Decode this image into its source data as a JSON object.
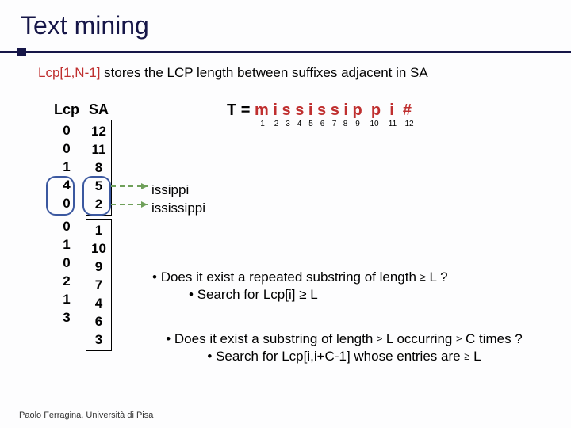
{
  "title": "Text mining",
  "subtitle_prefix": "Lcp[1,N-1]",
  "subtitle_rest": " stores the LCP length between suffixes adjacent in SA",
  "lcp_label": "Lcp",
  "sa_label": "SA",
  "lcp_values": [
    "0",
    "0",
    "1",
    "4",
    "0",
    "0",
    "1",
    "0",
    "2",
    "1",
    "3"
  ],
  "sa_values_top": [
    "12",
    "11",
    "8",
    "5",
    "2"
  ],
  "sa_values_bottom": [
    "1",
    "10",
    "9",
    "7",
    "4",
    "6",
    "3"
  ],
  "tstring": {
    "prefix": "T = ",
    "chars": [
      "m",
      "i",
      "s",
      "s",
      "i",
      "s",
      "s",
      "i",
      "p",
      "p",
      "i",
      "#"
    ],
    "nums": [
      "1",
      "2",
      "3",
      "4",
      "5",
      "6",
      "7",
      "8",
      "9",
      "10",
      "11",
      "12"
    ]
  },
  "suffixes": {
    "a": "issippi",
    "b": "ississippi"
  },
  "q1": {
    "line": "Does it exist a repeated substring of length ",
    "ge": "≥",
    "tail": " L ?",
    "sub": "Search for Lcp[i] ≥ L"
  },
  "q2": {
    "line": "Does it exist a substring of length ",
    "ge": "≥",
    "mid": " L occurring ",
    "tail": " C times ?",
    "sub": "Search for Lcp[i,i+C-1] whose entries are ",
    "subtail": " L"
  },
  "footer": "Paolo Ferragina, Università di Pisa"
}
